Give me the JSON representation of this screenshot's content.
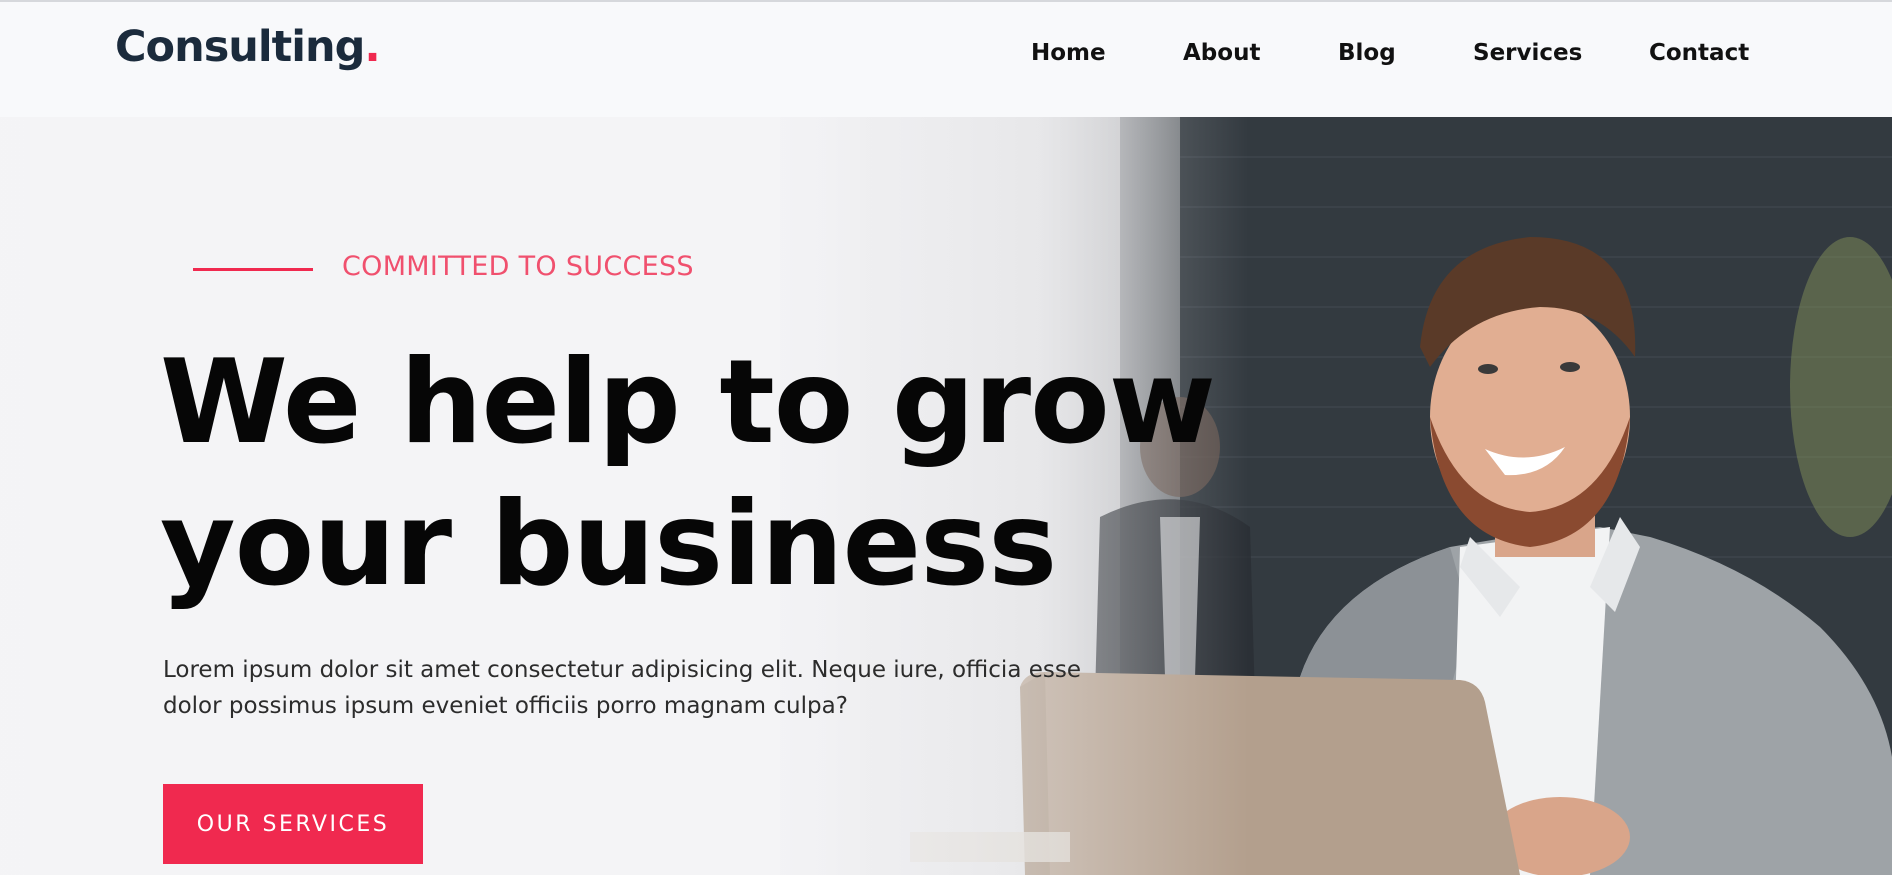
{
  "header": {
    "logo": {
      "text": "Consulting",
      "dot": "."
    },
    "nav": [
      {
        "label": "Home"
      },
      {
        "label": "About"
      },
      {
        "label": "Blog"
      },
      {
        "label": "Services"
      },
      {
        "label": "Contact"
      }
    ]
  },
  "hero": {
    "tagline": "COMMITTED TO SUCCESS",
    "headline_line1": "We help to grow",
    "headline_line2": "your business",
    "description": "Lorem ipsum dolor sit amet consectetur adipisicing elit. Neque iure, officia esse dolor possimus ipsum eveniet officiis porro magnam culpa?",
    "cta_label": "OUR SERVICES"
  },
  "colors": {
    "accent": "#f0294f",
    "logo_text": "#1b2b3c",
    "header_bg": "#f8f9fb"
  }
}
